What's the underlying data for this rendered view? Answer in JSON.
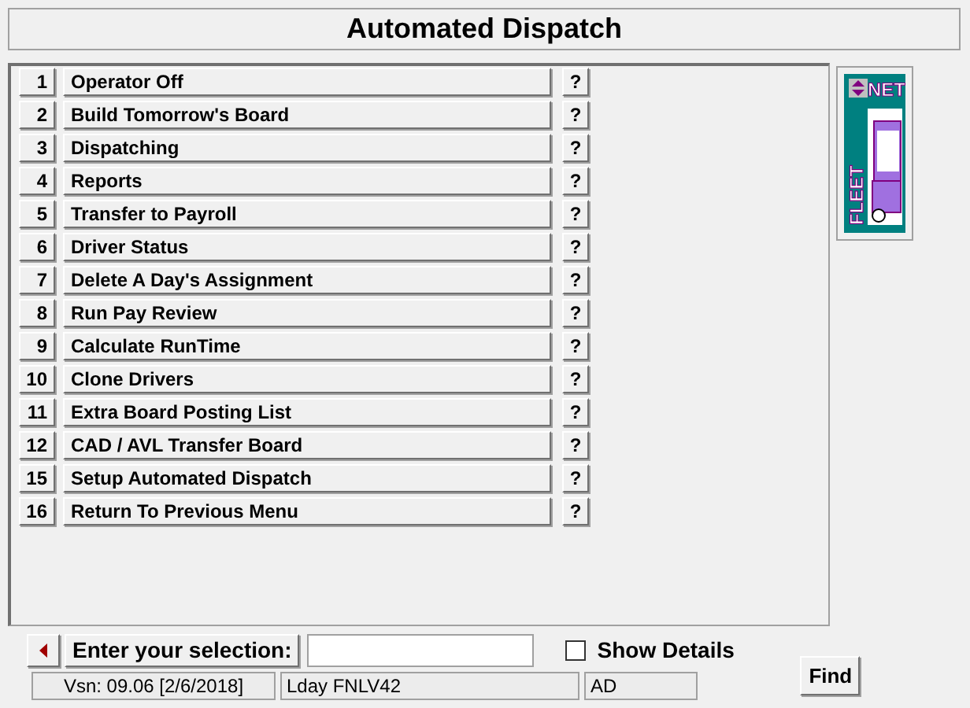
{
  "window": {
    "title": "Automated Dispatch"
  },
  "menu": [
    {
      "number": "1",
      "label": "Operator Off",
      "help": "?"
    },
    {
      "number": "2",
      "label": "Build Tomorrow's Board",
      "help": "?"
    },
    {
      "number": "3",
      "label": "Dispatching",
      "help": "?"
    },
    {
      "number": "4",
      "label": "Reports",
      "help": "?"
    },
    {
      "number": "5",
      "label": "Transfer to Payroll",
      "help": "?"
    },
    {
      "number": "6",
      "label": "Driver Status",
      "help": "?"
    },
    {
      "number": "7",
      "label": "Delete A Day's Assignment",
      "help": "?"
    },
    {
      "number": "8",
      "label": "Run Pay Review",
      "help": "?"
    },
    {
      "number": "9",
      "label": "Calculate RunTime",
      "help": "?"
    },
    {
      "number": "10",
      "label": "Clone Drivers",
      "help": "?"
    },
    {
      "number": "11",
      "label": "Extra Board Posting List",
      "help": "?"
    },
    {
      "number": "12",
      "label": "CAD / AVL Transfer Board",
      "help": "?"
    },
    {
      "number": "15",
      "label": "Setup Automated Dispatch",
      "help": "?"
    },
    {
      "number": "16",
      "label": "Return To Previous Menu",
      "help": "?"
    }
  ],
  "logo": {
    "top": "NET",
    "side": "FLEET"
  },
  "selection": {
    "label": "Enter your selection:"
  },
  "show_details": {
    "label": "Show Details",
    "checked": false
  },
  "find_button": "Find",
  "status_bar": [
    "Vsn: 09.06 [2/6/2018]",
    "Lday FNLV42",
    "AD"
  ]
}
